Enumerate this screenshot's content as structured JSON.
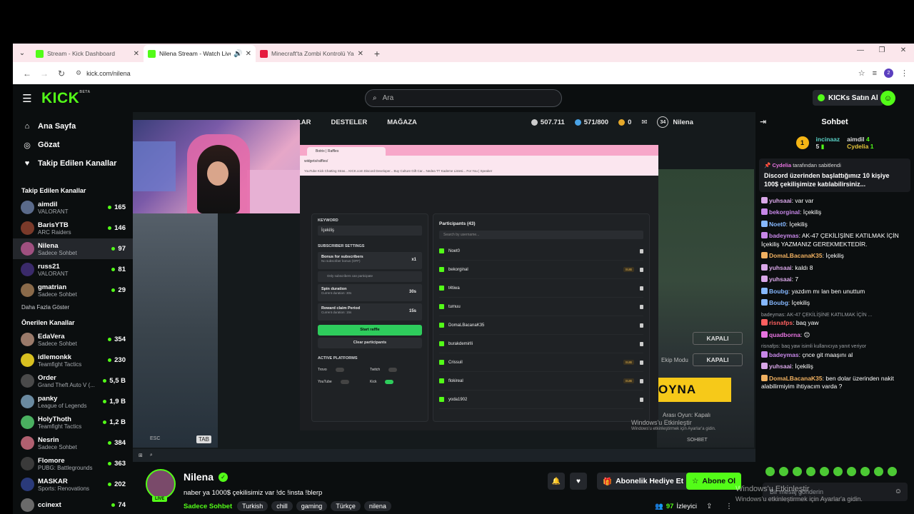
{
  "browser": {
    "tabs": [
      {
        "title": "Stream - Kick Dashboard",
        "color": "#53fc18"
      },
      {
        "title": "Nilena Stream - Watch Live",
        "color": "#53fc18"
      },
      {
        "title": "Minecraft'ta Zombi Kontrolü Ya",
        "color": "#e61a3e"
      }
    ],
    "url": "kick.com/nilena",
    "profile_initial": "2"
  },
  "kick": {
    "logo": "KICK",
    "logo_beta": "BETA",
    "search_placeholder": "Ara",
    "buy_label": "KICKs Satın Al"
  },
  "sidebar": {
    "nav": [
      {
        "label": "Ana Sayfa",
        "icon": "home-icon"
      },
      {
        "label": "Gözat",
        "icon": "compass-icon"
      },
      {
        "label": "Takip Edilen Kanallar",
        "icon": "heart-icon"
      }
    ],
    "following_title": "Takip Edilen Kanallar",
    "following": [
      {
        "name": "aimdil",
        "category": "VALORANT",
        "viewers": "165",
        "color": "#5a6a8a"
      },
      {
        "name": "BarisYTB",
        "category": "ARC Raiders",
        "viewers": "146",
        "color": "#7a3a2a"
      },
      {
        "name": "Nilena",
        "category": "Sadece Sohbet",
        "viewers": "97",
        "color": "#a05080"
      },
      {
        "name": "russ21",
        "category": "VALORANT",
        "viewers": "81",
        "color": "#3a2a6a"
      },
      {
        "name": "gmatrian",
        "category": "Sadece Sohbet",
        "viewers": "29",
        "color": "#8a6a4a"
      }
    ],
    "show_more": "Daha Fazla Göster",
    "recommended_title": "Önerilen Kanallar",
    "recommended": [
      {
        "name": "EdaVera",
        "category": "Sadece Sohbet",
        "viewers": "354",
        "color": "#9a7a6a"
      },
      {
        "name": "idlemonkk",
        "category": "Teamfight Tactics",
        "viewers": "230",
        "color": "#d8c020"
      },
      {
        "name": "Order",
        "category": "Grand Theft Auto V (...",
        "viewers": "5,5 B",
        "color": "#4a4a4a"
      },
      {
        "name": "panky",
        "category": "League of Legends",
        "viewers": "1,9 B",
        "color": "#6a8aa0"
      },
      {
        "name": "HolyThoth",
        "category": "Teamfight Tactics",
        "viewers": "1,2 B",
        "color": "#4ab060"
      },
      {
        "name": "Nesrin",
        "category": "Sadece Sohbet",
        "viewers": "384",
        "color": "#b06070"
      },
      {
        "name": "Flomore",
        "category": "PUBG: Battlegrounds",
        "viewers": "363",
        "color": "#3a3a3a"
      },
      {
        "name": "MASKAR",
        "category": "Sports: Renovations",
        "viewers": "202",
        "color": "#2a3a7a"
      },
      {
        "name": "ccinext",
        "category": "",
        "viewers": "74",
        "color": "#6a6a6a"
      }
    ]
  },
  "game": {
    "menu": [
      "LAR",
      "DESTELER",
      "MAĞAZA"
    ],
    "coins": "507.711",
    "xp": "571/800",
    "tokens": "0",
    "level": "34",
    "player": "Nilena",
    "kapali1": "KAPALI",
    "kapali2": "KAPALI",
    "ekip_modu": "Ekip Modu",
    "oyna": "OYNA",
    "ara_oyun": "Arası Oyun: Kapalı",
    "win_activate": "Windows'u Etkinleştir",
    "win_activate_sub": "Windows'u etkinleştirmek için Ayarlar'a gidin.",
    "sohbet": "SOHBET",
    "esc": "ESC",
    "tab_key": "TAB"
  },
  "raffle": {
    "browser_tab": "Botrix | Raffles",
    "url": "widgets/raffles/",
    "bookmarks": "YouTube   Kick Chatting Stras...   KICK.com   Discord Developer...   Buy Culture Gift Car...   Nedea   TT Kademe Listesi...   For You | Speaker",
    "keyword_label": "KEYWORD",
    "keyword": "İçekiliş",
    "sub_settings": "SUBSCRIBER SETTINGS",
    "bonus_title": "Bonus for subscribers",
    "bonus_sub": "No subscriber bonus (OFF)",
    "bonus_val": "x1",
    "only_subs": "Only subscribers can participate",
    "spin_title": "Spin duration",
    "spin_sub": "Current duration: 30s",
    "spin_val": "30s",
    "claim_title": "Reward claim Period",
    "claim_sub": "Current duration: 15s",
    "claim_val": "15s",
    "start": "Start raffle",
    "clear": "Clear participants",
    "platforms_label": "ACTIVE PLATFORMS",
    "platforms": [
      {
        "name": "Trovo",
        "on": false
      },
      {
        "name": "Twitch",
        "on": false
      },
      {
        "name": "YouTube",
        "on": false
      },
      {
        "name": "Kick",
        "on": true
      }
    ],
    "participants_title": "Participants (43)",
    "participants_search": "Search by username...",
    "participants": [
      {
        "name": "Noet0",
        "sub": ""
      },
      {
        "name": "bekorginal",
        "sub": "SUB"
      },
      {
        "name": "t4tiwa",
        "sub": ""
      },
      {
        "name": "tumuu",
        "sub": ""
      },
      {
        "name": "DomaLBacanaK35",
        "sub": ""
      },
      {
        "name": "burakdemirlli",
        "sub": ""
      },
      {
        "name": "Crissuil",
        "sub": "SUB"
      },
      {
        "name": "flokireal",
        "sub": "SUB"
      },
      {
        "name": "yoda1902",
        "sub": ""
      }
    ]
  },
  "stream": {
    "name": "Nilena",
    "live": "LIVE",
    "title": "naber ya 1000$ çekilisimiz var !dc !insta !blerp",
    "category": "Sadece Sohbet",
    "tags": [
      "Turkish",
      "chill",
      "gaming",
      "Türkçe",
      "nilena"
    ],
    "gift": "Abonelik Hediye Et",
    "subscribe": "Abone Ol",
    "viewers": "97",
    "viewers_label": "İzleyici"
  },
  "chat": {
    "title": "Sohbet",
    "leaderboard": [
      {
        "rank": "1",
        "name": "incinaaz",
        "count": "5"
      },
      {
        "name": "aimdil",
        "count": "4"
      },
      {
        "name": "Cydelia",
        "count": "1"
      }
    ],
    "pinned_by": "Cydelia",
    "pinned_suffix": "tarafından sabitlendi",
    "pinned_text": "Discord üzerinden başlattığımız 10 kişiye 100$ çekilişimize katılabilirsiniz...",
    "messages": [
      {
        "user": "yuhsaai",
        "color": "#d9a7e8",
        "text": "var var",
        "reply": ""
      },
      {
        "user": "bekorginal",
        "color": "#c787e8",
        "text": "İçekiliş",
        "reply": ""
      },
      {
        "user": "Noet0",
        "color": "#86b8ff",
        "text": "İçekiliş",
        "reply": ""
      },
      {
        "user": "badeymas",
        "color": "#c787e8",
        "text": "AK-47 ÇEKİLİŞİNE KATILMAK İÇİN İçekiliş YAZMANIZ GEREKMEKTEDİR.",
        "reply": ""
      },
      {
        "user": "DomaLBacanaK35",
        "color": "#f0b060",
        "text": "İçekiliş",
        "reply": ""
      },
      {
        "user": "yuhsaai",
        "color": "#d9a7e8",
        "text": "kaldı 8",
        "reply": ""
      },
      {
        "user": "yuhsaai",
        "color": "#d9a7e8",
        "text": "7",
        "reply": ""
      },
      {
        "user": "Boubg",
        "color": "#86b8ff",
        "text": "yazdım mı lan ben unuttum",
        "reply": ""
      },
      {
        "user": "Boubg",
        "color": "#86b8ff",
        "text": "İçekiliş",
        "reply": ""
      },
      {
        "user": "risnafps",
        "color": "#ff6060",
        "text": "baq yaw",
        "reply": "badeymas: AK-47 ÇEKİLİŞİNE KATILMAK İÇİN ..."
      },
      {
        "user": "quadborna",
        "color": "#e773e0",
        "text": "😊",
        "reply": ""
      },
      {
        "user": "badeymas",
        "color": "#c787e8",
        "text": "çnce git maaşını al",
        "reply": "risnafps: baq yaw isimli kullanıcıya yanıt veriyor"
      },
      {
        "user": "yuhsaai",
        "color": "#d9a7e8",
        "text": "İçekiliş",
        "reply": ""
      },
      {
        "user": "DomaLBacanaK35",
        "color": "#f0b060",
        "text": "ben dolar üzerinden nakit alabilirmiyim ihtiyacım varda ?",
        "reply": ""
      }
    ],
    "input_placeholder": "Bir mesaj gönderin",
    "win_overlay": "Windows'u Etkinleştir",
    "win_overlay_sub": "Windows'u etkinleştirmek için Ayarlar'a gidin."
  }
}
